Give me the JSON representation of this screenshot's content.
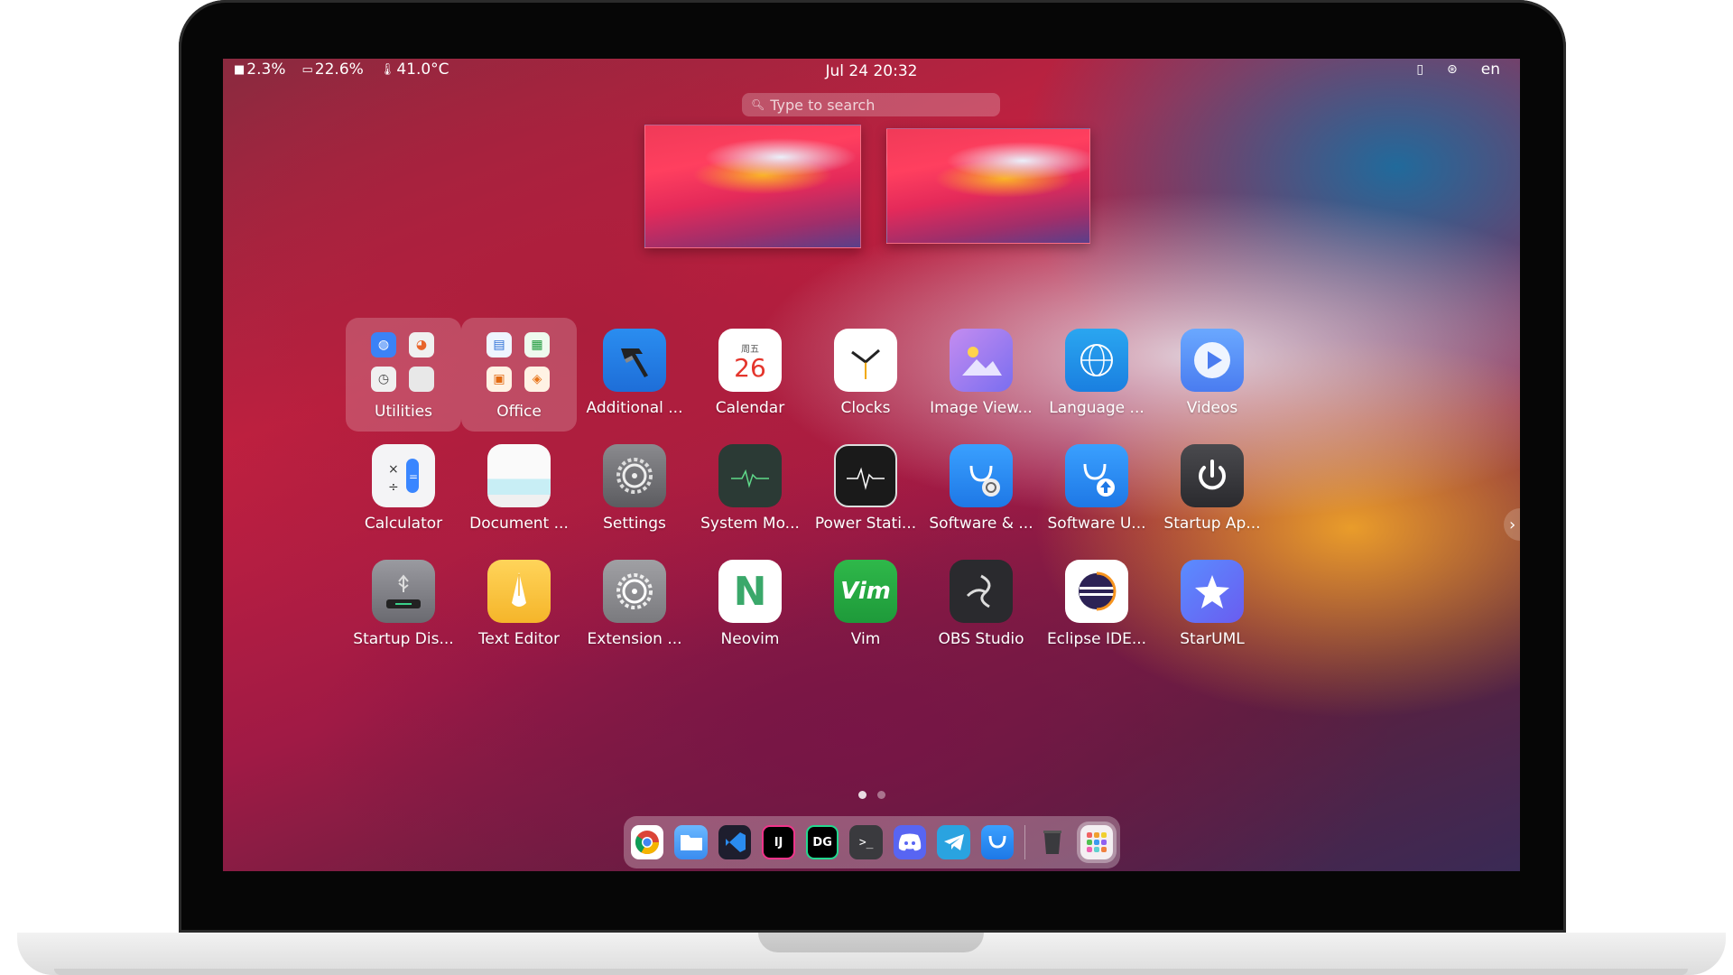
{
  "topbar": {
    "disk": "2.3%",
    "memory": "22.6%",
    "temperature": "41.0°C",
    "datetime": "Jul 24  20:32",
    "language": "en"
  },
  "search": {
    "placeholder": "Type to search"
  },
  "apps": [
    {
      "label": "Utilities",
      "icon": "utilities-folder-icon"
    },
    {
      "label": "Office",
      "icon": "office-folder-icon"
    },
    {
      "label": "Additional ...",
      "icon": "hammer-icon"
    },
    {
      "label": "Calendar",
      "icon": "calendar-icon",
      "day": "26",
      "weekday": "周五"
    },
    {
      "label": "Clocks",
      "icon": "clock-icon"
    },
    {
      "label": "Image View...",
      "icon": "image-viewer-icon"
    },
    {
      "label": "Language ...",
      "icon": "globe-icon"
    },
    {
      "label": "Videos",
      "icon": "play-icon"
    },
    {
      "label": "Calculator",
      "icon": "calculator-icon"
    },
    {
      "label": "Document ...",
      "icon": "document-icon"
    },
    {
      "label": "Settings",
      "icon": "gear-icon"
    },
    {
      "label": "System Mo...",
      "icon": "system-monitor-icon"
    },
    {
      "label": "Power Stati...",
      "icon": "power-statistics-icon"
    },
    {
      "label": "Software & ...",
      "icon": "software-sources-icon"
    },
    {
      "label": "Software U...",
      "icon": "software-updater-icon"
    },
    {
      "label": "Startup Ap...",
      "icon": "power-icon"
    },
    {
      "label": "Startup Dis...",
      "icon": "usb-drive-icon"
    },
    {
      "label": "Text Editor",
      "icon": "pen-icon"
    },
    {
      "label": "Extension ...",
      "icon": "extension-gear-icon"
    },
    {
      "label": "Neovim",
      "icon": "neovim-icon"
    },
    {
      "label": "Vim",
      "icon": "vim-icon"
    },
    {
      "label": "OBS Studio",
      "icon": "obs-icon"
    },
    {
      "label": "Eclipse IDE...",
      "icon": "eclipse-icon"
    },
    {
      "label": "StarUML",
      "icon": "star-icon"
    }
  ],
  "calendar": {
    "weekday": "周五",
    "day": "26"
  },
  "vim": {
    "glyph": "Vim"
  },
  "neovim": {
    "glyph": "N"
  },
  "dock": [
    {
      "name": "chrome-icon"
    },
    {
      "name": "files-icon"
    },
    {
      "name": "vscode-icon"
    },
    {
      "name": "intellij-icon",
      "text": "IJ"
    },
    {
      "name": "datagrip-icon",
      "text": "DG"
    },
    {
      "name": "terminal-icon",
      "text": ">_"
    },
    {
      "name": "discord-icon"
    },
    {
      "name": "telegram-icon"
    },
    {
      "name": "software-store-icon"
    },
    {
      "name": "trash-icon"
    },
    {
      "name": "app-grid-icon"
    }
  ],
  "pager": {
    "pages": 2,
    "current": 1
  }
}
